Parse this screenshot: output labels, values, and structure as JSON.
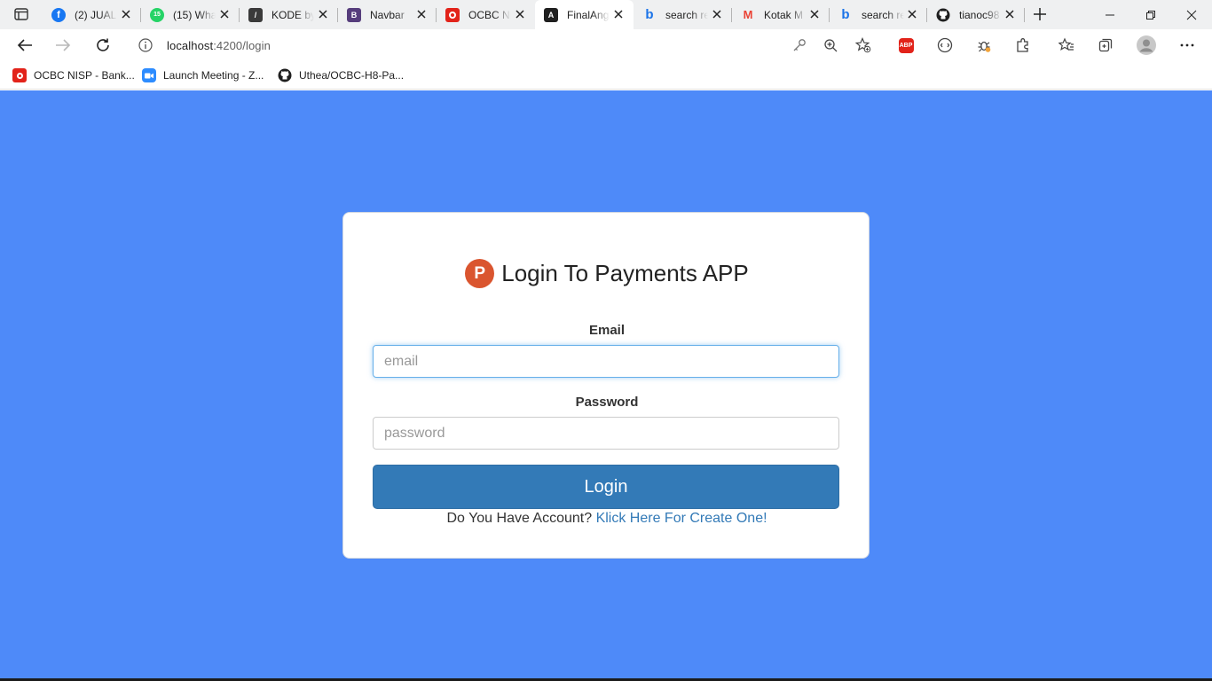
{
  "browser": {
    "tabs": [
      {
        "title": "(2) JUAL",
        "icon": "facebook-icon",
        "color": "#1877f2",
        "glyph": "f"
      },
      {
        "title": "(15) Wha",
        "icon": "whatsapp-icon",
        "color": "#25d366",
        "glyph": "15"
      },
      {
        "title": "KODE by",
        "icon": "kode-icon",
        "color": "#3a3a3a",
        "glyph": "/"
      },
      {
        "title": "Navbar",
        "icon": "bootstrap-icon",
        "color": "#563d7c",
        "glyph": "B"
      },
      {
        "title": "OCBC NI",
        "icon": "ocbc-icon",
        "color": "#e2231a",
        "glyph": "●"
      },
      {
        "title": "FinalAng",
        "icon": "angular-icon",
        "color": "#1f1f1f",
        "glyph": "A",
        "active": true
      },
      {
        "title": "search re",
        "icon": "bing-icon",
        "color": "#ffffff",
        "glyph": "b"
      },
      {
        "title": "Kotak M",
        "icon": "gmail-icon",
        "color": "#ffffff",
        "glyph": "M"
      },
      {
        "title": "search re",
        "icon": "bing-icon",
        "color": "#ffffff",
        "glyph": "b"
      },
      {
        "title": "tianoc98",
        "icon": "github-icon",
        "color": "#ffffff",
        "glyph": "●"
      }
    ],
    "url": {
      "host": "localhost",
      "path": ":4200/login"
    },
    "bookmarks": [
      {
        "label": "OCBC NISP - Bank...",
        "icon": "ocbc-icon"
      },
      {
        "label": "Launch Meeting - Z...",
        "icon": "zoom-icon"
      },
      {
        "label": "Uthea/OCBC-H8-Pa...",
        "icon": "github-icon"
      }
    ],
    "extensions": {
      "abp": "ABP"
    }
  },
  "login": {
    "logo_letter": "P",
    "title": "Login To Payments APP",
    "email_label": "Email",
    "email_placeholder": "email",
    "password_label": "Password",
    "password_placeholder": "password",
    "submit_label": "Login",
    "signup_prompt": "Do You Have Account? ",
    "signup_link": "Klick Here For Create One!"
  },
  "colors": {
    "page_background": "#4e8af9",
    "button": "#337ab7",
    "logo": "#da552f"
  }
}
